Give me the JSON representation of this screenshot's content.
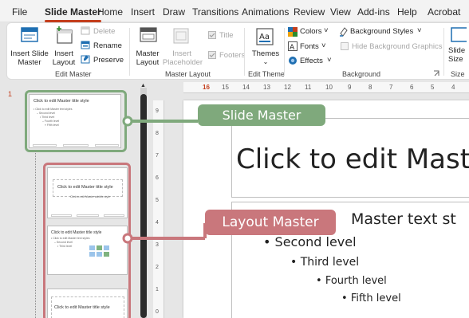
{
  "menu": {
    "items": [
      "File",
      "Slide Master",
      "Home",
      "Insert",
      "Draw",
      "Transitions",
      "Animations",
      "Review",
      "View",
      "Add-ins",
      "Help",
      "Acrobat"
    ],
    "active": "Slide Master"
  },
  "ribbon": {
    "edit_master": {
      "group_label": "Edit Master",
      "insert_slide_master": [
        "Insert Slide",
        "Master"
      ],
      "insert_layout": [
        "Insert",
        "Layout"
      ],
      "delete": "Delete",
      "rename": "Rename",
      "preserve": "Preserve"
    },
    "master_layout": {
      "group_label": "Master Layout",
      "master_layout_btn": [
        "Master",
        "Layout"
      ],
      "insert_placeholder": [
        "Insert",
        "Placeholder"
      ],
      "title_check": "Title",
      "footers_check": "Footers"
    },
    "edit_theme": {
      "group_label": "Edit Theme",
      "themes": "Themes"
    },
    "background": {
      "group_label": "Background",
      "colors": "Colors",
      "fonts": "Fonts",
      "effects": "Effects",
      "background_styles": "Background Styles",
      "hide_background_graphics": "Hide Background Graphics"
    },
    "size": {
      "group_label": "Size",
      "slide_size": [
        "Slide",
        "Size"
      ]
    }
  },
  "slide_pane": {
    "slide_number": "1",
    "master_thumb_title": "Click to edit Master title style",
    "master_thumb_lines": [
      "• Click to edit Master text styles",
      "– Second level",
      "• Third level",
      "– Fourth level",
      "» Fifth level"
    ],
    "layout1_title": "Click to edit Master title style",
    "layout1_sub": "Click to edit Master subtitle style",
    "layout2_title": "Click to edit Master title style",
    "layout3_title": "Click to edit Master title style"
  },
  "ruler": {
    "top": [
      "16",
      "15",
      "14",
      "13",
      "12",
      "11",
      "10",
      "9",
      "8",
      "7",
      "6",
      "5",
      "4"
    ],
    "left": [
      "9",
      "8",
      "7",
      "6",
      "5",
      "4",
      "3",
      "2",
      "1",
      "0"
    ]
  },
  "slide": {
    "title": "Click to edit Maste",
    "bullets": [
      "Master text st",
      "Second level",
      "Third level",
      "Fourth level",
      "Fifth level"
    ]
  },
  "callouts": {
    "slide_master": "Slide Master",
    "layout_master": "Layout Master",
    "green": "#7fa97c",
    "pink": "#c9777c"
  },
  "colors": {
    "accent": "#c43e1c",
    "ribbon_icon_blue": "#1f6fb2"
  }
}
